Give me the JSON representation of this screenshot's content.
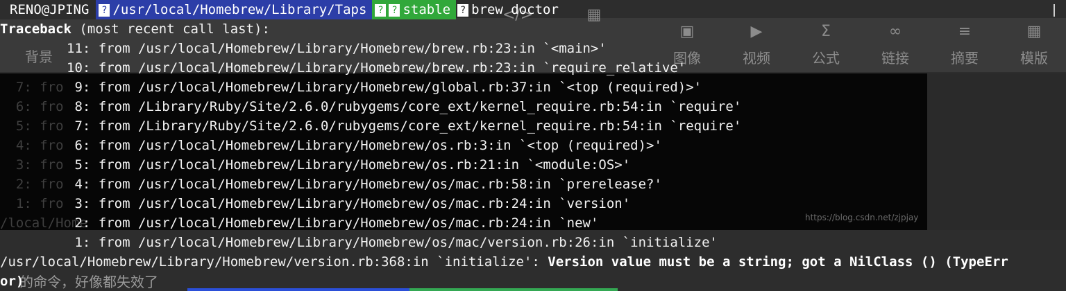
{
  "prompt": {
    "user_host": "RENO@JPING",
    "path": "/usr/local/Homebrew/Library/Taps",
    "branch": "stable",
    "command": "brew doctor",
    "glyph": "?"
  },
  "traceback_header": {
    "bold": "Traceback",
    "rest": " (most recent call last):"
  },
  "frames": [
    "11: from /usr/local/Homebrew/Library/Homebrew/brew.rb:23:in `<main>'",
    "10: from /usr/local/Homebrew/Library/Homebrew/brew.rb:23:in `require_relative'",
    " 9: from /usr/local/Homebrew/Library/Homebrew/global.rb:37:in `<top (required)>'",
    " 8: from /Library/Ruby/Site/2.6.0/rubygems/core_ext/kernel_require.rb:54:in `require'",
    " 7: from /Library/Ruby/Site/2.6.0/rubygems/core_ext/kernel_require.rb:54:in `require'",
    " 6: from /usr/local/Homebrew/Library/Homebrew/os.rb:3:in `<top (required)>'",
    " 5: from /usr/local/Homebrew/Library/Homebrew/os.rb:21:in `<module:OS>'",
    " 4: from /usr/local/Homebrew/Library/Homebrew/os/mac.rb:58:in `prerelease?'",
    " 3: from /usr/local/Homebrew/Library/Homebrew/os/mac.rb:24:in `version'",
    " 2: from /usr/local/Homebrew/Library/Homebrew/os/mac.rb:24:in `new'",
    " 1: from /usr/local/Homebrew/Library/Homebrew/os/mac/version.rb:26:in `initialize'"
  ],
  "error": {
    "location": "/usr/local/Homebrew/Library/Homebrew/version.rb:368:in `initialize': ",
    "message": "Version value must be a string; got a NilClass () (TypeErr",
    "message_wrap": "or)"
  },
  "background": {
    "left_label": "背景",
    "toolbar_items": [
      {
        "icon": "image-icon",
        "glyph": "▣",
        "label": "图像"
      },
      {
        "icon": "video-icon",
        "glyph": "▶",
        "label": "视频"
      },
      {
        "icon": "formula-icon",
        "glyph": "Σ",
        "label": "公式"
      },
      {
        "icon": "link-icon",
        "glyph": "∞",
        "label": "链接"
      },
      {
        "icon": "summary-icon",
        "glyph": "≡",
        "label": "摘要"
      },
      {
        "icon": "template-icon",
        "glyph": "▦",
        "label": "模版"
      }
    ],
    "toolbar_icons_top": [
      {
        "icon": "divider-icon",
        "glyph": "▬"
      },
      {
        "icon": "quote-icon",
        "glyph": "❝"
      },
      {
        "icon": "code-icon",
        "glyph": "</>"
      },
      {
        "icon": "table-icon",
        "glyph": "▦"
      }
    ],
    "ghost_lines": [
      "  7: fro",
      "  6: fro",
      "  5: fro",
      "  4: fro",
      "  3: fro",
      "  2: fro",
      "  1: fro",
      "/local/Home"
    ],
    "watermark": "https://blog.csdn.net/zjpjay",
    "bottom_text": "的命令，好像都失效了"
  }
}
